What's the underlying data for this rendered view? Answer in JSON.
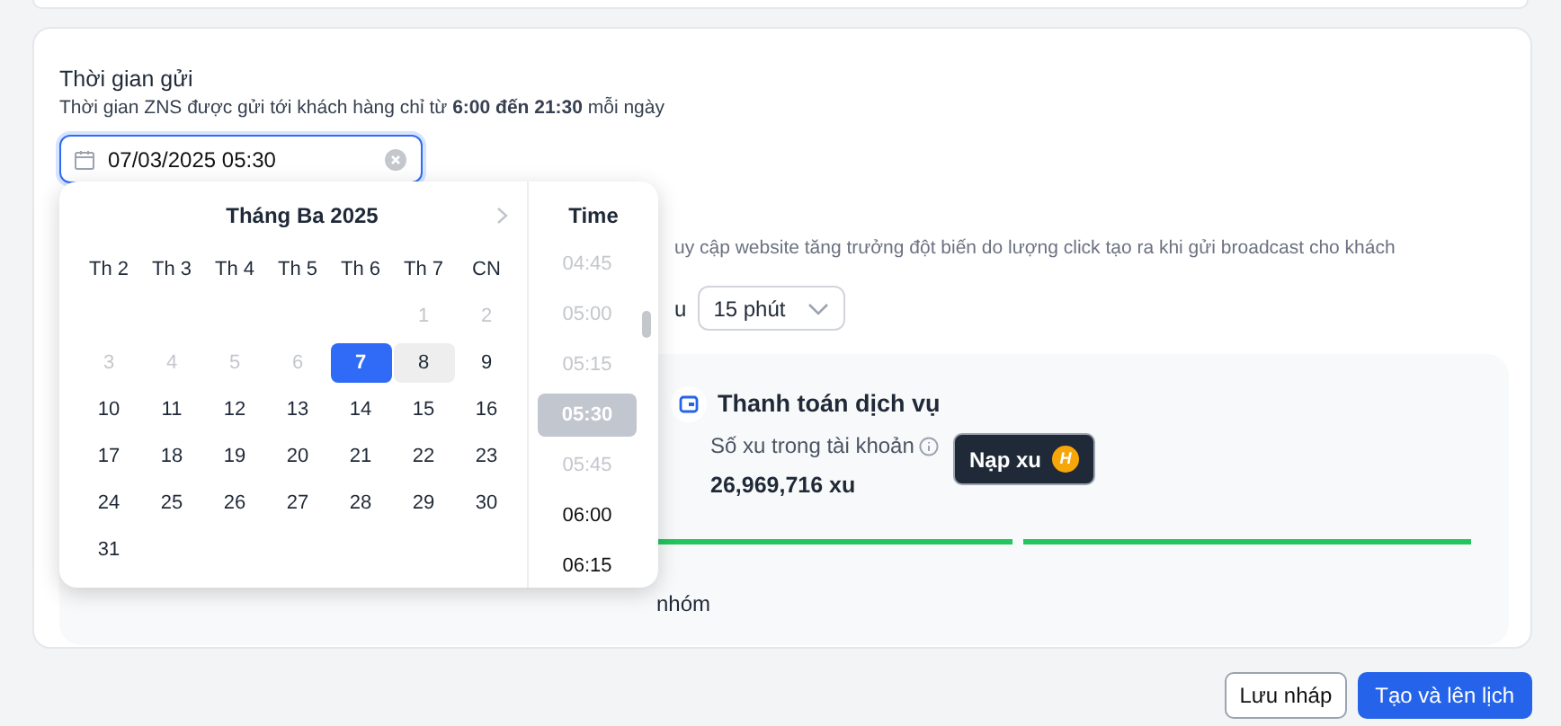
{
  "section": {
    "title": "Thời gian gửi",
    "hint": "Thời gian ZNS được gửi tới khách hàng chỉ từ **6:00 đến 21:30** mỗi ngày"
  },
  "datetime_field": {
    "value": "07/03/2025 05:30"
  },
  "calendar": {
    "month_title": "Tháng Ba 2025",
    "weekdays": [
      "Th 2",
      "Th 3",
      "Th 4",
      "Th 5",
      "Th 6",
      "Th 7",
      "CN"
    ],
    "weeks": [
      [
        {
          "day": "1",
          "disabled": true,
          "selected": false,
          "highlighted": false
        },
        {
          "day": "2",
          "disabled": true,
          "selected": false,
          "highlighted": false
        }
      ],
      [
        {
          "day": "3",
          "disabled": true,
          "selected": false,
          "highlighted": false
        },
        {
          "day": "4",
          "disabled": true,
          "selected": false,
          "highlighted": false
        },
        {
          "day": "5",
          "disabled": true,
          "selected": false,
          "highlighted": false
        },
        {
          "day": "6",
          "disabled": true,
          "selected": false,
          "highlighted": false
        },
        {
          "day": "7",
          "disabled": false,
          "selected": true,
          "highlighted": false
        },
        {
          "day": "8",
          "disabled": false,
          "selected": false,
          "highlighted": true
        },
        {
          "day": "9",
          "disabled": false,
          "selected": false,
          "highlighted": false
        }
      ],
      [
        {
          "day": "10",
          "disabled": false,
          "selected": false,
          "highlighted": false
        },
        {
          "day": "11",
          "disabled": false,
          "selected": false,
          "highlighted": false
        },
        {
          "day": "12",
          "disabled": false,
          "selected": false,
          "highlighted": false
        },
        {
          "day": "13",
          "disabled": false,
          "selected": false,
          "highlighted": false
        },
        {
          "day": "14",
          "disabled": false,
          "selected": false,
          "highlighted": false
        },
        {
          "day": "15",
          "disabled": false,
          "selected": false,
          "highlighted": false
        },
        {
          "day": "16",
          "disabled": false,
          "selected": false,
          "highlighted": false
        }
      ],
      [
        {
          "day": "17",
          "disabled": false,
          "selected": false,
          "highlighted": false
        },
        {
          "day": "18",
          "disabled": false,
          "selected": false,
          "highlighted": false
        },
        {
          "day": "19",
          "disabled": false,
          "selected": false,
          "highlighted": false
        },
        {
          "day": "20",
          "disabled": false,
          "selected": false,
          "highlighted": false
        },
        {
          "day": "21",
          "disabled": false,
          "selected": false,
          "highlighted": false
        },
        {
          "day": "22",
          "disabled": false,
          "selected": false,
          "highlighted": false
        },
        {
          "day": "23",
          "disabled": false,
          "selected": false,
          "highlighted": false
        }
      ],
      [
        {
          "day": "24",
          "disabled": false,
          "selected": false,
          "highlighted": false
        },
        {
          "day": "25",
          "disabled": false,
          "selected": false,
          "highlighted": false
        },
        {
          "day": "26",
          "disabled": false,
          "selected": false,
          "highlighted": false
        },
        {
          "day": "27",
          "disabled": false,
          "selected": false,
          "highlighted": false
        },
        {
          "day": "28",
          "disabled": false,
          "selected": false,
          "highlighted": false
        },
        {
          "day": "29",
          "disabled": false,
          "selected": false,
          "highlighted": false
        },
        {
          "day": "30",
          "disabled": false,
          "selected": false,
          "highlighted": false
        }
      ],
      [
        {
          "day": "31",
          "disabled": false,
          "selected": false,
          "highlighted": false
        }
      ]
    ]
  },
  "time_list": {
    "title": "Time",
    "items": [
      {
        "time": "04:45",
        "disabled": true,
        "selected": false
      },
      {
        "time": "05:00",
        "disabled": true,
        "selected": false
      },
      {
        "time": "05:15",
        "disabled": true,
        "selected": false
      },
      {
        "time": "05:30",
        "disabled": true,
        "selected": true
      },
      {
        "time": "05:45",
        "disabled": true,
        "selected": false
      },
      {
        "time": "06:00",
        "disabled": false,
        "selected": false
      },
      {
        "time": "06:15",
        "disabled": false,
        "selected": false
      }
    ]
  },
  "behind_popup": {
    "hint_fragment": "uy cập website tăng trưởng đột biến do lượng click tạo ra khi gửi broadcast cho khách",
    "label_fragment": "u",
    "interval_select": {
      "value": "15 phút"
    },
    "group_fragment": "nhóm"
  },
  "payment": {
    "title": "Thanh toán dịch vụ",
    "balance_label": "Số xu trong tài khoản",
    "balance_value": "26,969,716 xu",
    "topup_button": "Nạp xu",
    "coin_letter": "H"
  },
  "buttons": [
    {
      "label": "Lưu nháp",
      "kind": "secondary"
    },
    {
      "label": "Tạo và lên lịch",
      "kind": "primary"
    }
  ]
}
